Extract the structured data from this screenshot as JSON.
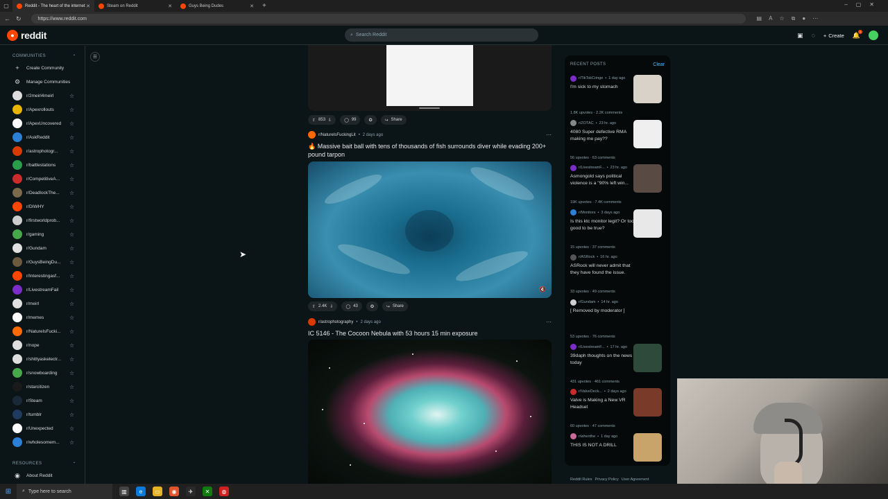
{
  "browser": {
    "tabs": [
      {
        "title": "Reddit - The heart of the internet",
        "active": true
      },
      {
        "title": "Steam on Reddit",
        "active": false
      },
      {
        "title": "Guys Being Dudes",
        "active": false
      }
    ],
    "url": "https://www.reddit.com"
  },
  "header": {
    "logo_text": "reddit",
    "search_placeholder": "Search Reddit",
    "create_label": "Create",
    "notification_count": "1"
  },
  "sidebar": {
    "communities_heading": "COMMUNITIES",
    "create_community": "Create Community",
    "manage_communities": "Manage Communities",
    "communities": [
      {
        "name": "r/2meirl4meirl",
        "color": "#dddddd"
      },
      {
        "name": "r/Apexrollouts",
        "color": "#e8b400"
      },
      {
        "name": "r/ApexUncovered",
        "color": "#ffffff"
      },
      {
        "name": "r/AskReddit",
        "color": "#2b7fd6"
      },
      {
        "name": "r/astrophotogr...",
        "color": "#d93a00"
      },
      {
        "name": "r/battlestations",
        "color": "#2a9d4a"
      },
      {
        "name": "r/CompetitiveA...",
        "color": "#cc2b2b"
      },
      {
        "name": "r/DeadlockThe...",
        "color": "#7a6a4a"
      },
      {
        "name": "r/DIWHY",
        "color": "#ff4500"
      },
      {
        "name": "r/firstworldprob...",
        "color": "#cccccc"
      },
      {
        "name": "r/gaming",
        "color": "#46a84a"
      },
      {
        "name": "r/Gundam",
        "color": "#e0e0e0"
      },
      {
        "name": "r/GuysBeingDu...",
        "color": "#6b5a3e"
      },
      {
        "name": "r/Interestingasf...",
        "color": "#ff4500"
      },
      {
        "name": "r/LivestreamFail",
        "color": "#7b2cc9"
      },
      {
        "name": "r/meirl",
        "color": "#e0e0e0"
      },
      {
        "name": "r/memes",
        "color": "#ffffff"
      },
      {
        "name": "r/NatureIsFucki...",
        "color": "#ff6a00"
      },
      {
        "name": "r/nope",
        "color": "#dddddd"
      },
      {
        "name": "r/shittyaskelectr...",
        "color": "#dddddd"
      },
      {
        "name": "r/snowboarding",
        "color": "#46a84a"
      },
      {
        "name": "r/starcitizen",
        "color": "#1a1a1a"
      },
      {
        "name": "r/Steam",
        "color": "#1b2838"
      },
      {
        "name": "r/tumblr",
        "color": "#1e3a5f"
      },
      {
        "name": "r/Unexpected",
        "color": "#ffffff"
      },
      {
        "name": "r/wholesomem...",
        "color": "#2b7fd6"
      }
    ],
    "resources_heading": "RESOURCES",
    "about_reddit": "About Reddit"
  },
  "feed": {
    "top_post_actions": {
      "votes": "853",
      "comments": "99",
      "share": "Share"
    },
    "post1": {
      "subreddit": "r/NatureIsFuckingLit",
      "age": "2 days ago",
      "title": "🔥 Massive bait ball with tens of thousands of fish surrounds diver while evading 200+ pound tarpon",
      "votes": "2.4K",
      "comments": "43",
      "share": "Share"
    },
    "post2": {
      "subreddit": "r/astrophotography",
      "age": "2 days ago",
      "title": "IC 5146 - The Cocoon Nebula with 53 hours 15 min exposure"
    }
  },
  "recent": {
    "heading": "RECENT POSTS",
    "clear": "Clear",
    "posts": [
      {
        "sub": "r/TikTokCringe",
        "age": "1 day ago",
        "title": "I'm sick to my stomach",
        "stats": "1.8K upvotes · 2.2K comments",
        "icon_color": "#7b2cc9",
        "thumb": "#d9d2c8"
      },
      {
        "sub": "r/ZOTAC",
        "age": "23 hr. ago",
        "title": "4080 Super defective RMA making me pay??",
        "stats": "56 upvotes · 63 comments",
        "icon_color": "#888888",
        "thumb": "#efefef"
      },
      {
        "sub": "r/LivestreamF...",
        "age": "23 hr. ago",
        "title": "Asmongold says political violence is a \"90% left win...",
        "stats": "19K upvotes · 7.4K comments",
        "icon_color": "#7b2cc9",
        "thumb": "#5a4a44"
      },
      {
        "sub": "r/Monitors",
        "age": "3 days ago",
        "title": "Is this ktc monitor legit? Or too good to be true?",
        "stats": "15 upvotes · 37 comments",
        "icon_color": "#2b7fd6",
        "thumb": "#e8e8e8"
      },
      {
        "sub": "r/ASRock",
        "age": "16 hr. ago",
        "title": "ASRock will never admit that they have found the issue. even if they have. Lega...",
        "stats": "33 upvotes · 49 comments",
        "icon_color": "#555555",
        "thumb": ""
      },
      {
        "sub": "r/Gundam",
        "age": "14 hr. ago",
        "title": "[ Removed by moderator ]",
        "stats": "53 upvotes · 76 comments",
        "icon_color": "#d0d0d0",
        "thumb": ""
      },
      {
        "sub": "r/LivestreamF...",
        "age": "17 hr. ago",
        "title": "39daph thoughts on the news today",
        "stats": "431 upvotes · 461 comments",
        "icon_color": "#7b2cc9",
        "thumb": "#2e4a3a"
      },
      {
        "sub": "r/ValveDeck...",
        "age": "2 days ago",
        "title": "Valve is Making a New VR Headset",
        "stats": "60 upvotes · 47 comments",
        "icon_color": "#cc2b2b",
        "thumb": "#7a3a2a"
      },
      {
        "sub": "r/whenthe",
        "age": "1 day ago",
        "title": "THIS IS NOT A DRILL",
        "stats": "39K upvotes · 201 comments",
        "icon_color": "#c96a9a",
        "thumb": "#c9a46a"
      }
    ],
    "footer": [
      "Reddit Rules",
      "Privacy Policy",
      "User Agreement"
    ]
  },
  "taskbar": {
    "search_placeholder": "Type here to search"
  }
}
